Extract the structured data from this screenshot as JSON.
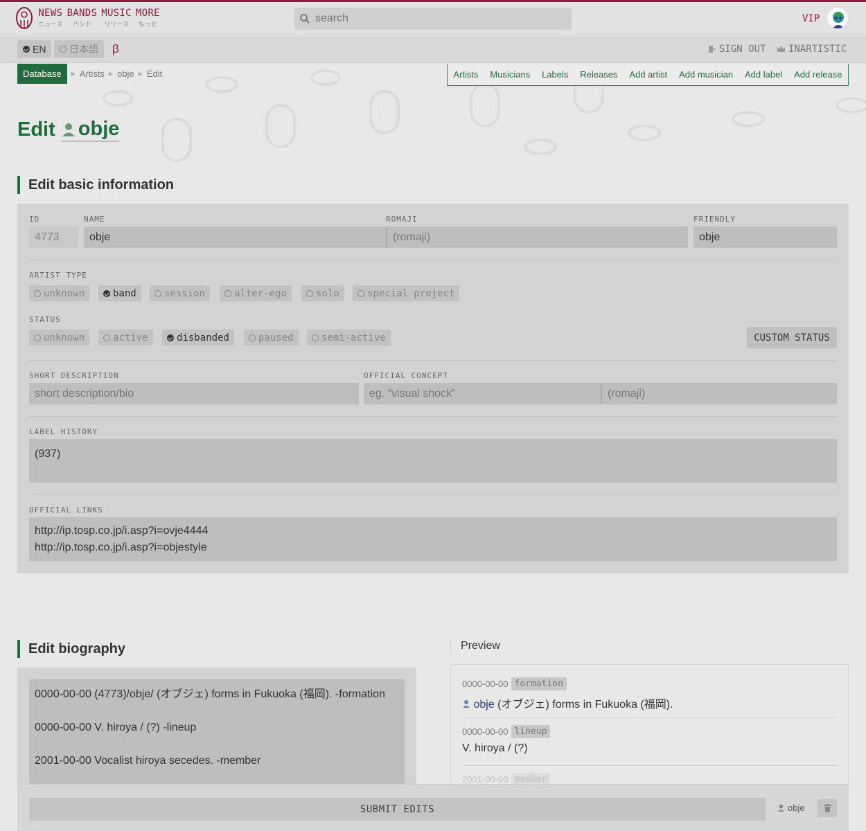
{
  "header": {
    "nav": [
      {
        "label": "NEWS",
        "jp": "ニュース"
      },
      {
        "label": "BANDS",
        "jp": "バンド"
      },
      {
        "label": "MUSIC",
        "jp": "リリース"
      },
      {
        "label": "MORE",
        "jp": "もっと"
      }
    ],
    "search_placeholder": "search",
    "vip_label": "VIP"
  },
  "subbar": {
    "lang_en": "EN",
    "lang_ja": "日本語",
    "beta": "β",
    "sign_out": "SIGN OUT",
    "inartistic": "INARTISTIC"
  },
  "breadcrumb": {
    "database": "Database",
    "items": [
      "Artists",
      "obje",
      "Edit"
    ]
  },
  "db_menu": [
    "Artists",
    "Musicians",
    "Labels",
    "Releases",
    "Add artist",
    "Add musician",
    "Add label",
    "Add release"
  ],
  "page": {
    "title_prefix": "Edit",
    "artist_name": "obje"
  },
  "basic": {
    "heading": "Edit basic information",
    "id_label": "ID",
    "id_value": "4773",
    "name_label": "NAME",
    "name_value": "obje",
    "romaji_label": "ROMAJI",
    "romaji_placeholder": "(romaji)",
    "friendly_label": "FRIENDLY",
    "friendly_value": "obje",
    "artist_type_label": "ARTIST TYPE",
    "artist_types": [
      "unknown",
      "band",
      "session",
      "alter-ego",
      "solo",
      "special project"
    ],
    "artist_type_selected": "band",
    "status_label": "STATUS",
    "statuses": [
      "unknown",
      "active",
      "disbanded",
      "paused",
      "semi-active"
    ],
    "status_selected": "disbanded",
    "custom_status": "CUSTOM STATUS",
    "short_desc_label": "SHORT DESCRIPTION",
    "short_desc_placeholder": "short description/bio",
    "concept_label": "OFFICIAL CONCEPT",
    "concept_placeholder": "eg. “visual shock”",
    "concept_romaji_placeholder": "(romaji)",
    "label_history_label": "LABEL HISTORY",
    "label_history_value": "(937)",
    "official_links_label": "OFFICIAL LINKS",
    "official_links": [
      "http://ip.tosp.co.jp/i.asp?i=ovje4444",
      "http://ip.tosp.co.jp/i.asp?i=objestyle"
    ]
  },
  "biography": {
    "heading": "Edit biography",
    "lines": [
      "0000-00-00 (4773)/obje/ (オブジェ) forms in Fukuoka (福岡). -formation",
      "0000-00-00 V. hiroya / (?) -lineup",
      "2001-00-00 Vocalist hiroya secedes. -member"
    ]
  },
  "preview": {
    "heading": "Preview",
    "items": [
      {
        "date": "0000-00-00",
        "tag": "formation",
        "link": "obje",
        "text": "(オブジェ) forms in Fukuoka (福岡)."
      },
      {
        "date": "0000-00-00",
        "tag": "lineup",
        "text": "V. hiroya / (?)"
      },
      {
        "date": "2001-00-00",
        "tag": "member"
      }
    ]
  },
  "footer": {
    "submit": "SUBMIT EDITS",
    "artist": "obje"
  },
  "colors": {
    "accent_green": "#1f6b3e",
    "brand_red": "#8b1e3f",
    "link_blue": "#1f3e8a"
  }
}
